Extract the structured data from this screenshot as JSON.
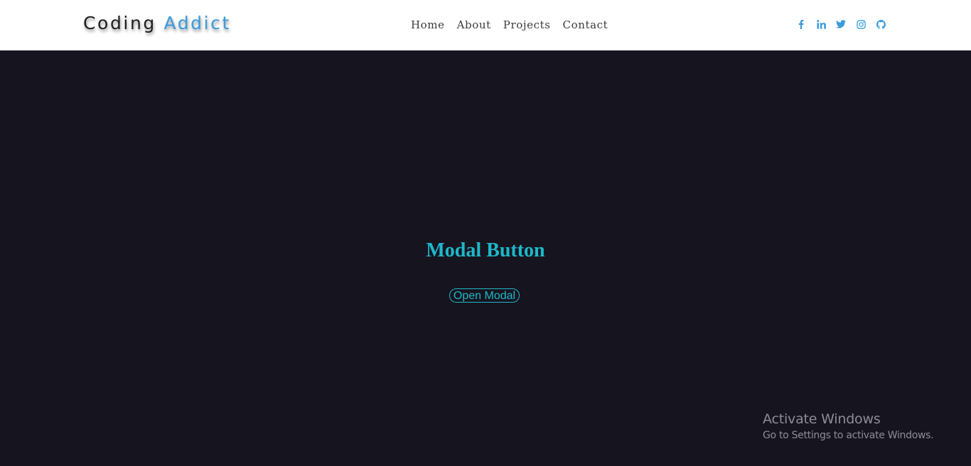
{
  "brand": {
    "first_word": "Coding",
    "second_word": "Addict",
    "colors": {
      "first": "#1f1f1f",
      "second": "#3a9bdc"
    }
  },
  "nav": {
    "items": [
      {
        "label": "Home"
      },
      {
        "label": "About"
      },
      {
        "label": "Projects"
      },
      {
        "label": "Contact"
      }
    ]
  },
  "social": {
    "icons": [
      "facebook-icon",
      "linkedin-icon",
      "twitter-icon",
      "instagram-icon",
      "github-icon"
    ],
    "color": "#3a9bdc"
  },
  "hero": {
    "title": "Modal Button",
    "button_label": "Open Modal",
    "accent": "#1eb8c9",
    "background": "#16141f"
  },
  "watermark": {
    "title": "Activate Windows",
    "subtitle": "Go to Settings to activate Windows."
  }
}
